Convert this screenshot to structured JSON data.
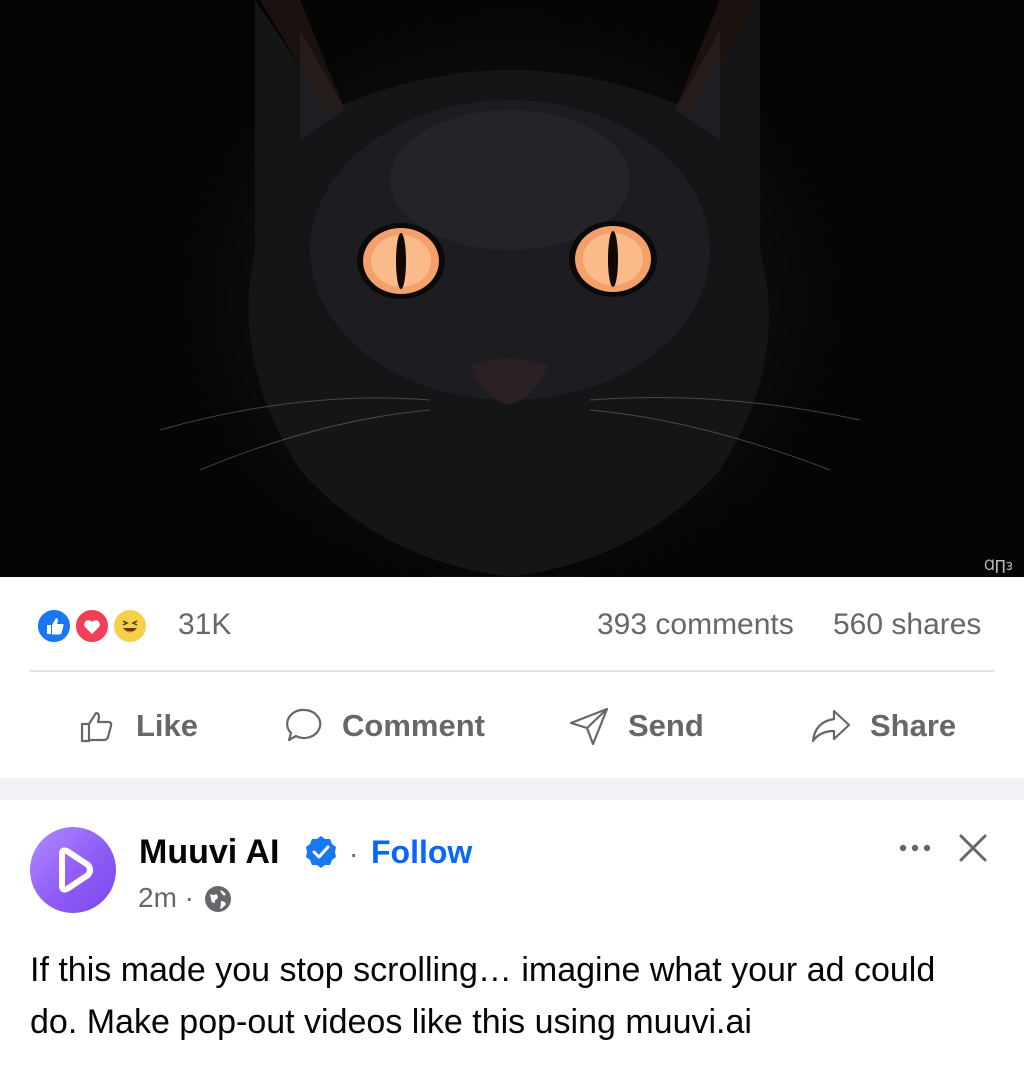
{
  "post_media": {
    "description_icon": "cat-image",
    "watermark": "Ɑ∏ᴈ"
  },
  "engagement": {
    "reaction_count": "31K",
    "comments": "393 comments",
    "shares": "560 shares",
    "reaction_icons": [
      "like-icon",
      "love-icon",
      "haha-icon"
    ]
  },
  "actions": {
    "like": "Like",
    "comment": "Comment",
    "send": "Send",
    "share": "Share"
  },
  "next_post": {
    "page_name": "Muuvi AI",
    "separator": "·",
    "follow": "Follow",
    "time": "2m ·",
    "text": "If this made you stop scrolling… imagine what your ad could do. Make pop-out videos like this using muuvi.ai"
  },
  "colors": {
    "brand_blue": "#0866ff",
    "secondary_text": "#65676b",
    "avatar_purple": "#8f5cf5"
  }
}
